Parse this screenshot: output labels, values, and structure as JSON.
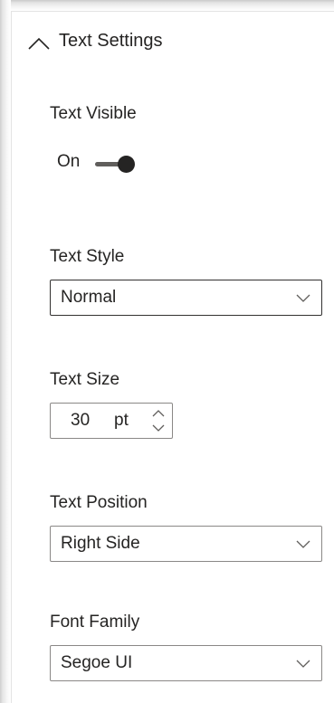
{
  "section": {
    "title": "Text Settings",
    "icon": "chevron-up-icon"
  },
  "text_visible": {
    "label": "Text Visible",
    "toggle_state": "On",
    "toggle_on": true
  },
  "text_style": {
    "label": "Text Style",
    "selected": "Normal",
    "icon": "chevron-down-icon"
  },
  "text_size": {
    "label": "Text Size",
    "value": "30",
    "unit": "pt",
    "icons": [
      "chevron-up-icon",
      "chevron-down-icon"
    ]
  },
  "text_position": {
    "label": "Text Position",
    "selected": "Right Side",
    "icon": "chevron-down-icon"
  },
  "font_family": {
    "label": "Font Family",
    "selected": "Segoe UI",
    "icon": "chevron-down-icon"
  },
  "colors": {
    "text": "#252423",
    "border": "#8a8886",
    "border_focused": "#323130",
    "toggle": "#252423"
  }
}
